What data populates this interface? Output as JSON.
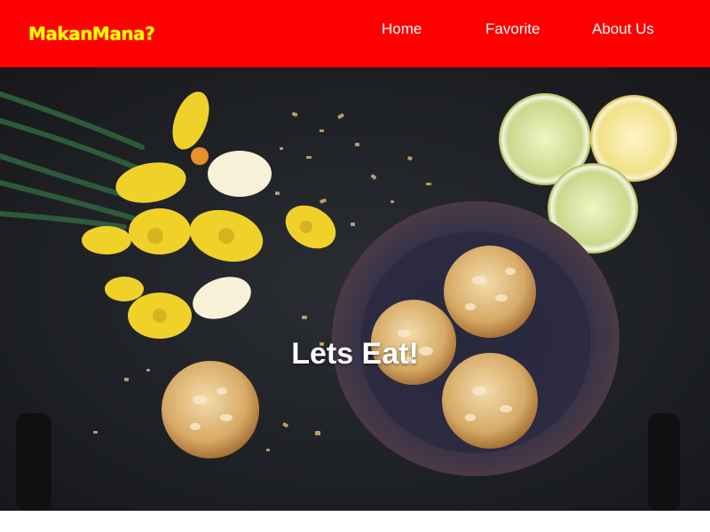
{
  "header": {
    "brand": "MakanMana?",
    "nav": [
      {
        "label": "Home"
      },
      {
        "label": "Favorite"
      },
      {
        "label": "About Us"
      }
    ]
  },
  "hero": {
    "title": "Lets Eat!"
  },
  "colors": {
    "navbar_bg": "#ff0000",
    "brand": "#ffff00",
    "nav_text": "#ffffff"
  }
}
